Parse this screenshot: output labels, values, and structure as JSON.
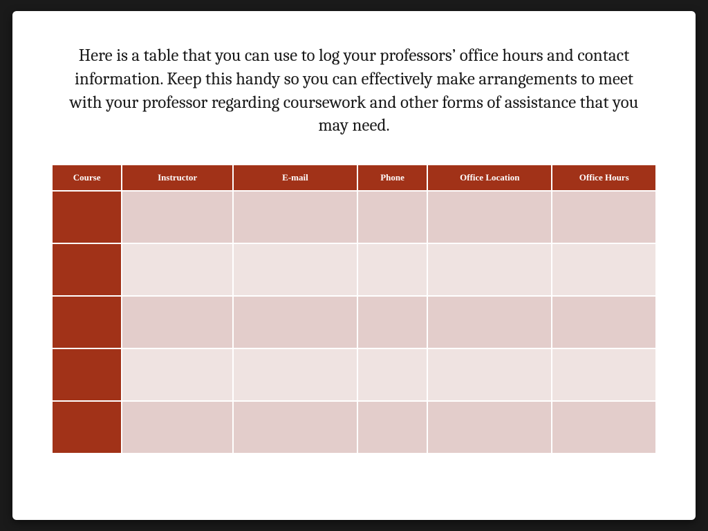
{
  "description": "Here is a table that you can use to log your professors’ office hours and contact information. Keep this handy so you can effectively make arrangements to meet with your professor regarding coursework and other forms of assistance that you may need.",
  "table": {
    "headers": [
      "Course",
      "Instructor",
      "E-mail",
      "Phone",
      "Office Location",
      "Office Hours"
    ],
    "rows": [
      {
        "course": "",
        "instructor": "",
        "email": "",
        "phone": "",
        "location": "",
        "hours": ""
      },
      {
        "course": "",
        "instructor": "",
        "email": "",
        "phone": "",
        "location": "",
        "hours": ""
      },
      {
        "course": "",
        "instructor": "",
        "email": "",
        "phone": "",
        "location": "",
        "hours": ""
      },
      {
        "course": "",
        "instructor": "",
        "email": "",
        "phone": "",
        "location": "",
        "hours": ""
      },
      {
        "course": "",
        "instructor": "",
        "email": "",
        "phone": "",
        "location": "",
        "hours": ""
      }
    ]
  }
}
